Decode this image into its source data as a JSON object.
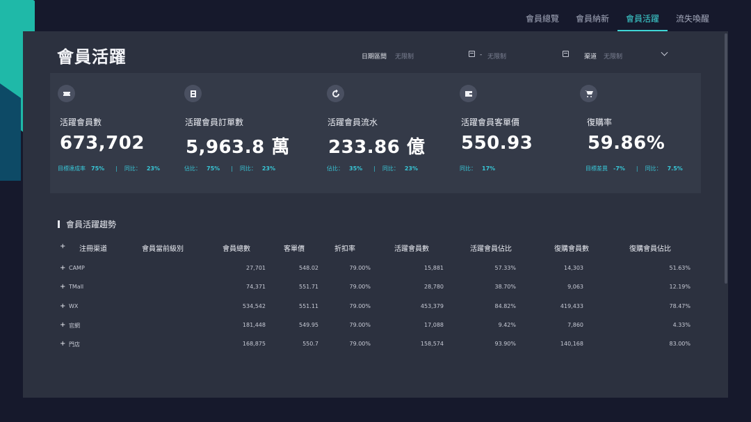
{
  "nav": {
    "tabs": [
      "會員總覽",
      "會員納新",
      "會員活躍",
      "流失喚醒"
    ],
    "active": 2
  },
  "page": {
    "title": "會員活躍"
  },
  "filters": {
    "date_label": "日期區間",
    "date_start": "无限制",
    "date_sep": "-",
    "date_end": "无限制",
    "channel_label": "渠道",
    "channel_value": "无限制"
  },
  "kpis": [
    {
      "icon": "coupon-icon",
      "label": "活躍會員數",
      "value": "673,702",
      "sub": [
        {
          "k": "目標達成率",
          "v": "75%"
        },
        {
          "k": "同比：",
          "v": "23%"
        }
      ]
    },
    {
      "icon": "ticket-icon",
      "label": "活躍會員訂單數",
      "value": "5,963.8 萬",
      "sub": [
        {
          "k": "佔比：",
          "v": "75%"
        },
        {
          "k": "同比：",
          "v": "23%"
        }
      ]
    },
    {
      "icon": "refresh-icon",
      "label": "活躍會員流水",
      "value": "233.86 億",
      "sub": [
        {
          "k": "佔比：",
          "v": "35%"
        },
        {
          "k": "同比：",
          "v": "23%"
        }
      ]
    },
    {
      "icon": "wallet-icon",
      "label": "活躍會員客單價",
      "value": "550.93",
      "sub": [
        {
          "k": "同比：",
          "v": "17%"
        }
      ]
    },
    {
      "icon": "cart-icon",
      "label": "復購率",
      "value": "59.86%",
      "sub": [
        {
          "k": "目標差異",
          "v": "-7%"
        },
        {
          "k": "同比：",
          "v": "7.5%"
        }
      ]
    }
  ],
  "trend": {
    "title": "會員活躍趨勢",
    "headers": [
      "注冊渠道",
      "會員當前級別",
      "會員總數",
      "客單價",
      "折扣率",
      "活躍會員數",
      "活躍會員佔比",
      "復購會員數",
      "復購會員佔比"
    ],
    "rows": [
      [
        "CAMP",
        "",
        "27,701",
        "548.02",
        "79.00%",
        "15,881",
        "57.33%",
        "14,303",
        "51.63%"
      ],
      [
        "TMall",
        "",
        "74,371",
        "551.71",
        "79.00%",
        "28,780",
        "38.70%",
        "9,063",
        "12.19%"
      ],
      [
        "WX",
        "",
        "534,542",
        "551.11",
        "79.00%",
        "453,379",
        "84.82%",
        "419,433",
        "78.47%"
      ],
      [
        "官網",
        "",
        "181,448",
        "549.95",
        "79.00%",
        "17,088",
        "9.42%",
        "7,860",
        "4.33%"
      ],
      [
        "門店",
        "",
        "168,875",
        "550.7",
        "79.00%",
        "158,574",
        "93.90%",
        "140,168",
        "83.00%"
      ]
    ]
  }
}
